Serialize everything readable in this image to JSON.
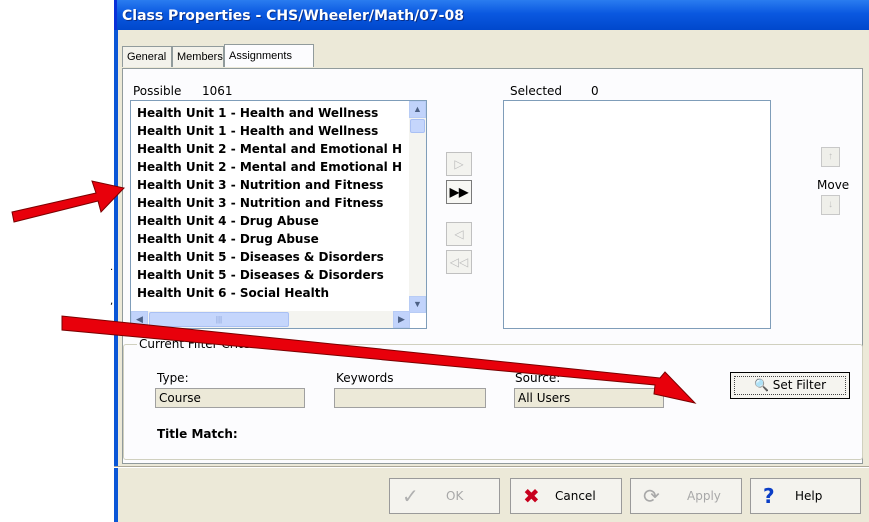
{
  "window": {
    "title": "Class Properties - CHS/Wheeler/Math/07-08"
  },
  "tabs": [
    {
      "label": "General"
    },
    {
      "label": "Members"
    },
    {
      "label": "Assignments"
    }
  ],
  "possible": {
    "label": "Possible",
    "count": "1061",
    "items": [
      "Health Unit 1 - Health and Wellness",
      "Health Unit 1 - Health and Wellness",
      "Health Unit 2 - Mental and Emotional H",
      "Health Unit 2 - Mental and Emotional H",
      "Health Unit 3 - Nutrition and Fitness",
      "Health Unit 3 - Nutrition and Fitness",
      "Health Unit 4 - Drug Abuse",
      "Health Unit 4 - Drug Abuse",
      "Health Unit 5 - Diseases & Disorders",
      "Health Unit 5 - Diseases & Disorders",
      "Health Unit 6 - Social Health"
    ]
  },
  "selected": {
    "label": "Selected",
    "count": "0"
  },
  "move": {
    "label": "Move"
  },
  "filter": {
    "group_title": "Current Filter Criteria",
    "type_label": "Type:",
    "type_value": "Course",
    "keywords_label": "Keywords",
    "keywords_value": "",
    "source_label": "Source:",
    "source_value": "All Users",
    "title_match_label": "Title Match:",
    "set_filter_label": "Set Filter"
  },
  "buttons": {
    "ok": "OK",
    "cancel": "Cancel",
    "apply": "Apply",
    "help": "Help"
  },
  "colors": {
    "title_bar": "#0a58e0",
    "annotation_arrow": "#e8000b"
  }
}
